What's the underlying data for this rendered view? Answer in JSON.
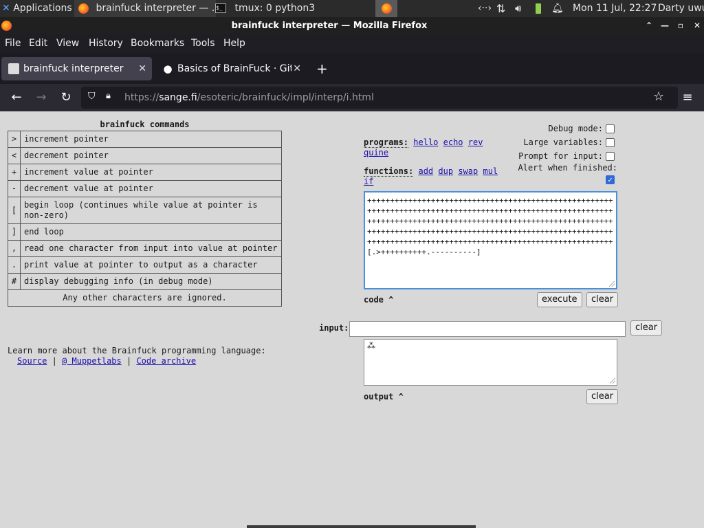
{
  "panel": {
    "applications": "Applications",
    "task1": "brainfuck interpreter — ...",
    "task2": "tmux: 0 python3",
    "datetime": "Mon 11 Jul, 22:27",
    "user": "Darty uwu"
  },
  "window": {
    "title": "brainfuck interpreter — Mozilla Firefox"
  },
  "menu": [
    "File",
    "Edit",
    "View",
    "History",
    "Bookmarks",
    "Tools",
    "Help"
  ],
  "tabs": [
    {
      "label": "brainfuck interpreter",
      "active": true
    },
    {
      "label": "Basics of BrainFuck · GitHub",
      "active": false
    }
  ],
  "url": {
    "prefix": "https://",
    "host": "sange.fi",
    "path": "/esoteric/brainfuck/impl/interp/i.html"
  },
  "page": {
    "commands_title": "brainfuck commands",
    "commands": [
      {
        "symbol": ">",
        "desc": "increment pointer"
      },
      {
        "symbol": "<",
        "desc": "decrement pointer"
      },
      {
        "symbol": "+",
        "desc": "increment value at pointer"
      },
      {
        "symbol": "-",
        "desc": "decrement value at pointer"
      },
      {
        "symbol": "[",
        "desc": "begin loop (continues while value at pointer is non-zero)"
      },
      {
        "symbol": "]",
        "desc": "end loop"
      },
      {
        "symbol": ",",
        "desc": "read one character from input into value at pointer"
      },
      {
        "symbol": ".",
        "desc": "print value at pointer to output as a character"
      },
      {
        "symbol": "#",
        "desc": "display debugging info (in debug mode)"
      }
    ],
    "commands_footer": "Any other characters are ignored.",
    "learn_text": "Learn more about the Brainfuck programming language:",
    "learn_links": [
      "Source",
      "@ Muppetlabs",
      "Code archive"
    ],
    "programs_label": "programs:",
    "programs": [
      "hello",
      "echo",
      "rev",
      "quine"
    ],
    "functions_label": "functions:",
    "functions": [
      "add",
      "dup",
      "swap",
      "mul",
      "if"
    ],
    "options": [
      {
        "label": "Debug mode:",
        "checked": false
      },
      {
        "label": "Large variables:",
        "checked": false
      },
      {
        "label": "Prompt for input:",
        "checked": false
      },
      {
        "label": "Alert when finished:",
        "checked": true
      }
    ],
    "code": "++++++++++++++++++++++++++++++++++++++++++++++++++++++++++++++++++++++++++++++++++++++++++++++++++++++++++++++++++++++++++++++++++++++++++++++++++++++++++++++++++++++++++++++++++++++++++++++++++++++++++++++++++++++++++++++++++++++++++++++++++++++++++++++++++++++++++++++[.>++++++++++.----------]",
    "code_label": "code ^",
    "execute_label": "execute",
    "clear_label": "clear",
    "input_label": "input:",
    "input_value": "",
    "output_label": "output ^",
    "output_value": "⁂"
  }
}
